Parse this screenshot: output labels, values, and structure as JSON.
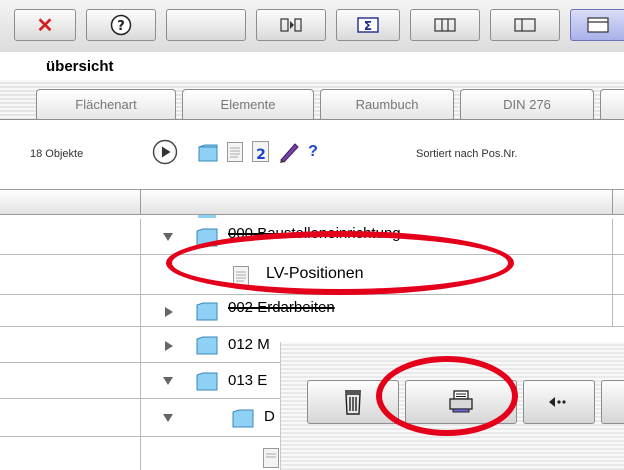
{
  "toolbar": {
    "buttons": [
      "close-icon",
      "help-icon",
      "empty",
      "play-step-icon",
      "sum-icon",
      "columns-icon",
      "split-view-icon",
      "window-icon"
    ]
  },
  "section": {
    "title": "übersicht"
  },
  "tabs": [
    {
      "label": "Flächenart"
    },
    {
      "label": "Elemente"
    },
    {
      "label": "Raumbuch"
    },
    {
      "label": "DIN 276"
    }
  ],
  "info": {
    "count": "18 Objekte",
    "sort": "Sortiert nach Pos.Nr.",
    "help_glyph": "?"
  },
  "tree": {
    "rows": [
      {
        "label": "000 Baustelleneinrichtung",
        "expanded": true
      },
      {
        "label": "LV-Positionen"
      },
      {
        "label": "002 Erdarbeiten",
        "expanded": false
      },
      {
        "label": "012 M",
        "expanded": false
      },
      {
        "label": "013 E",
        "expanded": true
      },
      {
        "label": "D",
        "expanded": true
      }
    ]
  },
  "panel": {
    "buttons": [
      "trash-icon",
      "print-icon",
      "back-arrow-icon"
    ]
  },
  "colors": {
    "annotation": "#e4001b",
    "active_button": "#a9b1ea",
    "close_red": "#d22020"
  }
}
